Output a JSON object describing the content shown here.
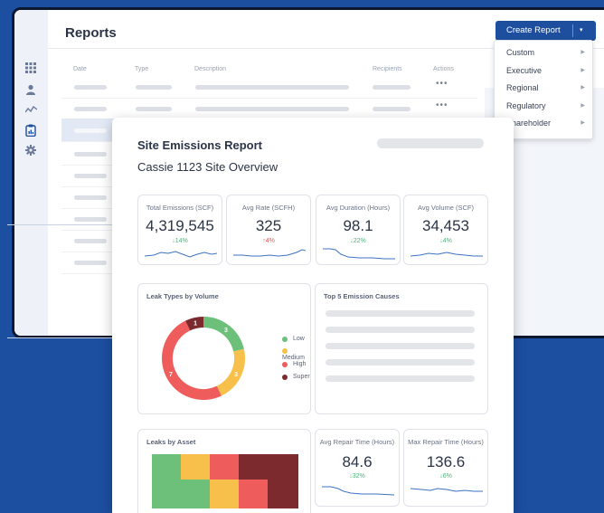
{
  "app": {
    "title": "Reports",
    "create_button": "Create Report",
    "create_caret": "▾",
    "table_headers": [
      "Date",
      "Type",
      "Description",
      "Recipients",
      "Actions"
    ],
    "row_actions": "•••",
    "rail_icons": [
      "apps-grid-icon",
      "user-icon",
      "trend-line-icon",
      "clipboard-report-icon",
      "gear-icon"
    ]
  },
  "dropdown": {
    "items": [
      "Custom",
      "Executive",
      "Regional",
      "Regulatory",
      "Shareholder"
    ],
    "arrow": "▶"
  },
  "report": {
    "title": "Site Emissions Report",
    "subtitle": "Cassie 1123 Site Overview",
    "kpis": [
      {
        "label": "Total Emissions (SCF)",
        "value": "4,319,545",
        "change": "↓14%",
        "direction": "down"
      },
      {
        "label": "Avg Rate (SCFH)",
        "value": "325",
        "change": "↑4%",
        "direction": "up"
      },
      {
        "label": "Avg Duration (Hours)",
        "value": "98.1",
        "change": "↓22%",
        "direction": "down"
      },
      {
        "label": "Avg Volume (SCF)",
        "value": "34,453",
        "change": "↓4%",
        "direction": "down"
      }
    ],
    "leak_types": {
      "title": "Leak Types by Volume",
      "segments": [
        {
          "name": "Low",
          "value": 3,
          "label": "3",
          "color": "#6cc07a"
        },
        {
          "name": "Medium",
          "value": 3,
          "label": "3",
          "color": "#f7c04a"
        },
        {
          "name": "High",
          "value": 7,
          "label": "7",
          "color": "#ee5c5c"
        },
        {
          "name": "Super",
          "value": 1,
          "label": "1",
          "color": "#7d2a2e"
        }
      ]
    },
    "top_causes": {
      "title": "Top 5 Emission Causes"
    },
    "leaks_by_asset": {
      "title": "Leaks by Asset"
    },
    "repair": [
      {
        "label": "Avg Repair Time (Hours)",
        "value": "84.6",
        "change": "↓32%",
        "direction": "down"
      },
      {
        "label": "Max Repair Time (Hours)",
        "value": "136.6",
        "change": "↓6%",
        "direction": "down"
      }
    ]
  },
  "colors": {
    "background": "#1c4fa0",
    "accent": "#1d4f9e",
    "positive": "#4bb37a",
    "negative": "#e05a5a",
    "sparkline": "#3d72c4"
  }
}
